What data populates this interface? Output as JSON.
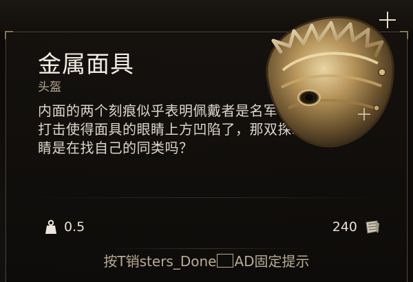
{
  "tooltip": {
    "item_name": "金属面具",
    "item_type": "头盔",
    "description": "内面的两个刻痕似乎表明佩戴者是名军官。沉重的打击使得面具的眼睛上方凹陷了，那双探求的大眼睛是在找自己的同类吗？",
    "weight": "0.5",
    "weight_icon": "weight-icon",
    "price": "240",
    "price_icon": "gold-coins-icon",
    "hint_prefix": "按T销sters_Done",
    "hint_suffix": "AD固定提示",
    "item_icon": "metal-mask-icon"
  },
  "colors": {
    "panel_border": "#5a4a38",
    "title_text": "#f2ede3",
    "subtitle_text": "#b7aa92",
    "body_text": "#ddd6ca",
    "hint_text": "#b8ab94",
    "gold": "#b89a5a"
  }
}
